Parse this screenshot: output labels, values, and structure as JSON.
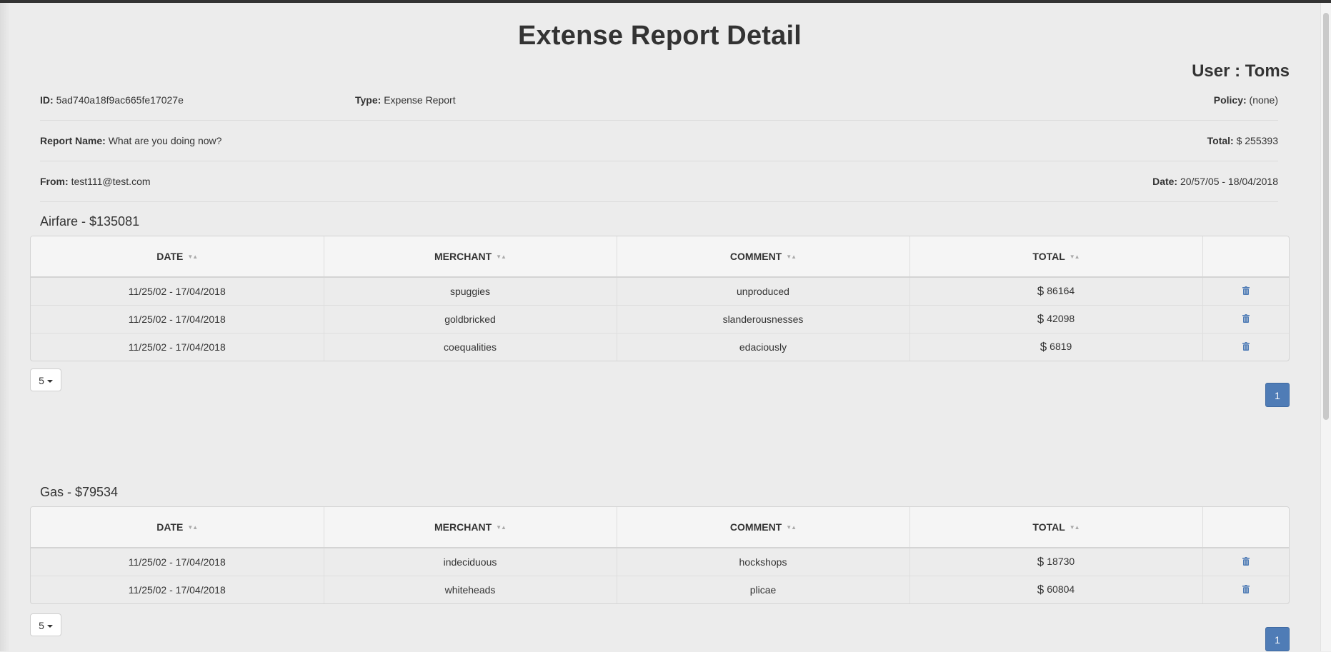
{
  "page": {
    "title": "Extense Report Detail",
    "user": "User : Toms"
  },
  "info": {
    "id_label": "ID:",
    "id_value": "5ad740a18f9ac665fe17027e",
    "type_label": "Type:",
    "type_value": "Expense Report",
    "policy_label": "Policy:",
    "policy_value": "(none)",
    "report_name_label": "Report Name:",
    "report_name_value": "What are you doing now?",
    "total_label": "Total:",
    "total_value": "$ 255393",
    "from_label": "From:",
    "from_value": "test111@test.com",
    "date_label": "Date:",
    "date_value": "20/57/05 - 18/04/2018"
  },
  "columns": [
    "DATE",
    "MERCHANT",
    "COMMENT",
    "TOTAL"
  ],
  "sections": [
    {
      "title": "Airfare - $135081",
      "rows": [
        {
          "date": "11/25/02 - 17/04/2018",
          "merchant": "spuggies",
          "comment": "unproduced",
          "currency": "$",
          "total": "86164"
        },
        {
          "date": "11/25/02 - 17/04/2018",
          "merchant": "goldbricked",
          "comment": "slanderousnesses",
          "currency": "$",
          "total": "42098"
        },
        {
          "date": "11/25/02 - 17/04/2018",
          "merchant": "coequalities",
          "comment": "edaciously",
          "currency": "$",
          "total": "6819"
        }
      ],
      "page_size": "5",
      "page": "1"
    },
    {
      "title": "Gas - $79534",
      "rows": [
        {
          "date": "11/25/02 - 17/04/2018",
          "merchant": "indeciduous",
          "comment": "hockshops",
          "currency": "$",
          "total": "18730"
        },
        {
          "date": "11/25/02 - 17/04/2018",
          "merchant": "whiteheads",
          "comment": "plicae",
          "currency": "$",
          "total": "60804"
        }
      ],
      "page_size": "5",
      "page": "1"
    }
  ],
  "icons": {
    "delete": "trash-icon",
    "sort": "sort-icon",
    "dropdown": "caret-down-icon"
  },
  "colors": {
    "accent": "#4f7cb6",
    "background": "#ececec",
    "header_bg": "#f5f5f5"
  }
}
